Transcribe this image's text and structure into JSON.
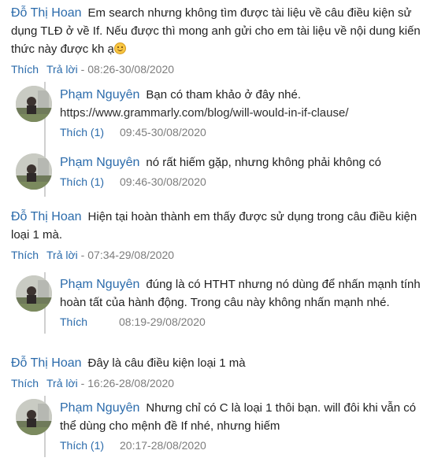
{
  "comments": [
    {
      "author": "Đỗ Thị Hoan",
      "text": "Em search nhưng không tìm được tài liệu về câu điều kiện sử dụng TLĐ ở về If. Nếu được thì mong anh gửi cho em tài liệu về nội dung kiến thức này được kh ạ",
      "emoji": "smiling-face-icon",
      "like_label": "Thích",
      "reply_label": "Trả lời",
      "timestamp": "08:26-30/08/2020",
      "replies": [
        {
          "author": "Phạm Nguyên",
          "text": "Bạn có tham khảo ở đây nhé.",
          "link": "https://www.grammarly.com/blog/will-would-in-if-clause/",
          "like_label": "Thích (1)",
          "timestamp": "09:45-30/08/2020"
        },
        {
          "author": "Phạm Nguyên",
          "text": "nó rất hiếm gặp, nhưng không phải không có",
          "like_label": "Thích (1)",
          "timestamp": "09:46-30/08/2020"
        }
      ]
    },
    {
      "author": "Đỗ Thị Hoan",
      "text": "Hiện tại hoàn thành em thấy được sử dụng trong câu điều kiện loại 1 mà.",
      "like_label": "Thích",
      "reply_label": "Trả lời",
      "timestamp": "07:34-29/08/2020",
      "replies": [
        {
          "author": "Phạm Nguyên",
          "text": "đúng là có HTHT nhưng nó dùng để nhấn mạnh tính hoàn tất của hành động. Trong câu này không nhấn mạnh nhé.",
          "like_label": "Thích",
          "timestamp": "08:19-29/08/2020"
        }
      ]
    },
    {
      "author": "Đỗ Thị Hoan",
      "text": "Đây là câu điều kiện loại 1 mà",
      "like_label": "Thích",
      "reply_label": "Trả lời",
      "timestamp": "16:26-28/08/2020",
      "replies": [
        {
          "author": "Phạm Nguyên",
          "text": "Nhưng chỉ có C là loại 1 thôi bạn. will đôi khi vẫn có thể dùng cho mệnh đề If nhé, nhưng hiếm",
          "like_label": "Thích (1)",
          "timestamp": "20:17-28/08/2020"
        }
      ]
    }
  ],
  "colors": {
    "author": "#2b6bab",
    "link": "#2b6bab",
    "meta": "#7d7d7d",
    "thread_line": "#d0d0d0"
  }
}
